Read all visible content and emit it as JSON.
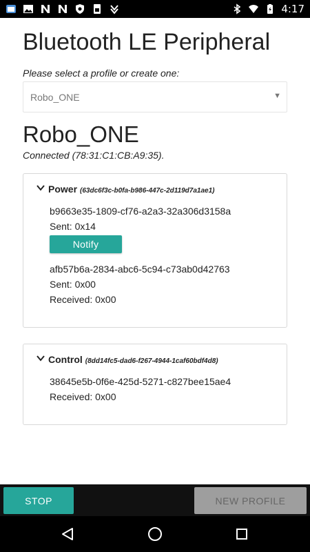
{
  "status_bar": {
    "time": "4:17",
    "left_icons": [
      "app-notification-icon",
      "image-icon",
      "n-icon",
      "n-icon",
      "shield-icon",
      "sim-icon",
      "download-icon"
    ],
    "right_icons": [
      "bluetooth-icon",
      "wifi-icon",
      "battery-icon"
    ]
  },
  "header": {
    "title": "Bluetooth LE Peripheral"
  },
  "profile_select": {
    "prompt": "Please select a profile or create one:",
    "selected": "Robo_ONE"
  },
  "device": {
    "name": "Robo_ONE",
    "status": "Connected (78:31:C1:CB:A9:35)."
  },
  "services": [
    {
      "name": "Power",
      "uuid": "(63dc6f3c-b0fa-b986-447c-2d119d7a1ae1)",
      "characteristics": [
        {
          "uuid": "b9663e35-1809-cf76-a2a3-32a306d3158a",
          "sent": "Sent: 0x14",
          "button": "Notify"
        },
        {
          "uuid": "afb57b6a-2834-abc6-5c94-c73ab0d42763",
          "sent": "Sent: 0x00",
          "received": "Received: 0x00"
        }
      ]
    },
    {
      "name": "Control",
      "uuid": "(8dd14fc5-dad6-f267-4944-1caf60bdf4d8)",
      "characteristics": [
        {
          "uuid": "38645e5b-0f6e-425d-5271-c827bee15ae4",
          "received": "Received: 0x00"
        }
      ]
    }
  ],
  "actions": {
    "stop": "STOP",
    "new_profile": "NEW PROFILE"
  },
  "colors": {
    "accent": "#26a69a",
    "disabled": "#9e9e9e"
  }
}
